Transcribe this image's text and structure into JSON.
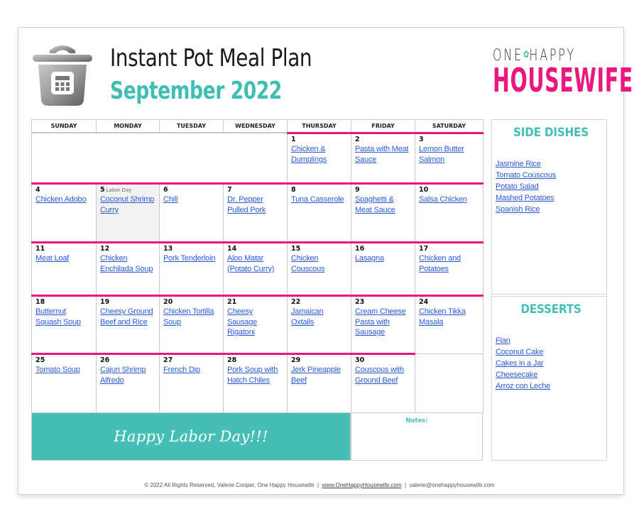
{
  "header": {
    "title": "Instant Pot Meal Plan",
    "subtitle": "September 2022",
    "logo_top": "ONE",
    "logo_top_right": "HAPPY",
    "logo_bow": "✿",
    "logo_bottom": "HOUSEWIFE"
  },
  "calendar": {
    "weekdays": [
      "SUNDAY",
      "MONDAY",
      "TUESDAY",
      "WEDNESDAY",
      "THURSDAY",
      "FRIDAY",
      "SATURDAY"
    ],
    "weeks": [
      [
        null,
        null,
        null,
        null,
        {
          "day": "1",
          "meal": "Chicken & Dumplings"
        },
        {
          "day": "2",
          "meal": "Pasta with Meat Sauce"
        },
        {
          "day": "3",
          "meal": "Lemon Butter Salmon"
        }
      ],
      [
        {
          "day": "4",
          "meal": "Chicken Adobo"
        },
        {
          "day": "5",
          "holiday": "Labor Day",
          "meal": "Coconut Shrimp Curry"
        },
        {
          "day": "6",
          "meal": "Chili"
        },
        {
          "day": "7",
          "meal": "Dr. Pepper Pulled Pork"
        },
        {
          "day": "8",
          "meal": "Tuna Casserole"
        },
        {
          "day": "9",
          "meal": "Spaghetti & Meat Sauce"
        },
        {
          "day": "10",
          "meal": "Salsa Chicken"
        }
      ],
      [
        {
          "day": "11",
          "meal": "Meat Loaf"
        },
        {
          "day": "12",
          "meal": "Chicken Enchilada Soup"
        },
        {
          "day": "13",
          "meal": "Pork Tenderloin"
        },
        {
          "day": "14",
          "meal": "Aloo Matar (Potato Curry)"
        },
        {
          "day": "15",
          "meal": "Chicken Couscous"
        },
        {
          "day": "16",
          "meal": "Lasagna"
        },
        {
          "day": "17",
          "meal": "Chicken and Potatoes"
        }
      ],
      [
        {
          "day": "18",
          "meal": "Butternut Squash Soup"
        },
        {
          "day": "19",
          "meal": "Cheesy Ground Beef and Rice"
        },
        {
          "day": "20",
          "meal": "Chicken Tortilla Soup"
        },
        {
          "day": "21",
          "meal": "Cheesy Sausage Rigatoni"
        },
        {
          "day": "22",
          "meal": "Jamaican Oxtails"
        },
        {
          "day": "23",
          "meal": "Cream Cheese Pasta with Sausage"
        },
        {
          "day": "24",
          "meal": "Chicken Tikka Masala"
        }
      ],
      [
        {
          "day": "25",
          "meal": "Tomato Soup"
        },
        {
          "day": "26",
          "meal": "Cajun Shrimp Alfredo"
        },
        {
          "day": "27",
          "meal": "French Dip"
        },
        {
          "day": "28",
          "meal": "Pork Soup with Hatch Chiles"
        },
        {
          "day": "29",
          "meal": "Jerk Pineapple Beef"
        },
        {
          "day": "30",
          "meal": "Couscous with Ground Beef"
        },
        null
      ]
    ],
    "banner": "Happy Labor Day!!!",
    "notes_label": "Notes:"
  },
  "sidebar": {
    "side_dishes": {
      "title": "SIDE DISHES",
      "items": [
        "Jasmine Rice",
        "Tomato Couscous",
        "Potato Salad",
        "Mashed Potatoes",
        "Spanish Rice"
      ]
    },
    "desserts": {
      "title": "DESSERTS",
      "items": [
        "Flan",
        "Coconut Cake",
        "Cakes in a Jar",
        "Cheesecake",
        "Arroz con Leche"
      ]
    }
  },
  "footer": {
    "copyright": "© 2022 All Rights Reserved, Valerie Cooper, One Happy Housewife",
    "separator": "|",
    "website": "www.OneHappyHousewife.com",
    "email": "valerie@onehappyhousewife.com"
  },
  "colors": {
    "accent_teal": "#45bfb6",
    "accent_pink": "#e9177f",
    "link_blue": "#2a5bd7"
  }
}
